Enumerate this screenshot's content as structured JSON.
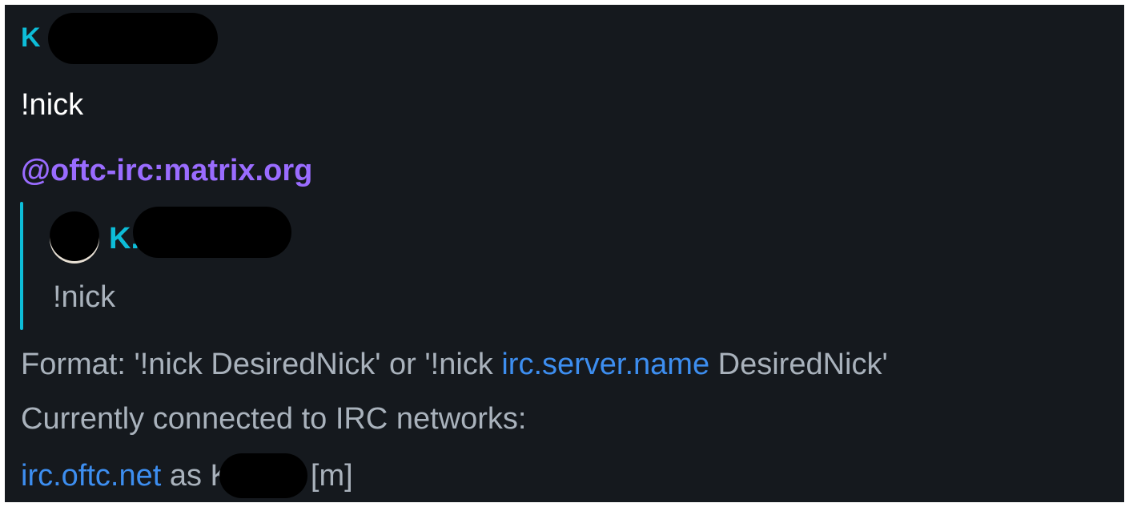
{
  "message": {
    "sender_initial": "K",
    "text": "!nick"
  },
  "reply": {
    "bot_name": "@oftc-irc:matrix.org",
    "quoted_sender_initial": "K.",
    "quoted_text": "!nick",
    "format_prefix": "Format: '!nick DesiredNick' or '!nick ",
    "format_link": "irc.server.name",
    "format_suffix": " DesiredNick'",
    "connected_line": "Currently connected to IRC networks:",
    "network_link": "irc.oftc.net",
    "network_as": " as K",
    "network_mode": "[m]"
  },
  "colors": {
    "background": "#15191e",
    "sender": "#0dbdd8",
    "bot": "#9a6cff",
    "link": "#3d8ef0",
    "muted_text": "#a9b2bc"
  }
}
